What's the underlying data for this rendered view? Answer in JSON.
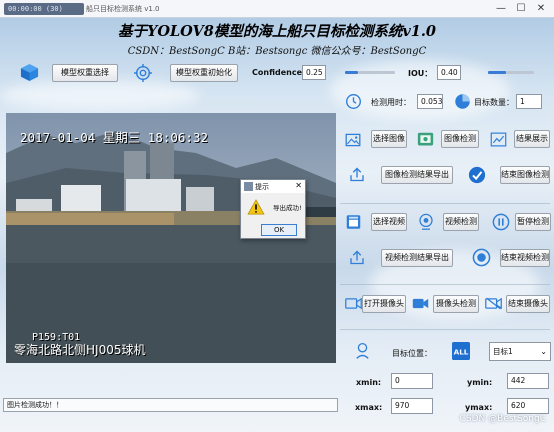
{
  "window": {
    "title_prefix": "基于YOLOv8",
    "fps_readout": "00:00:00 (30)",
    "title": "船只目标检测系统 v1.0",
    "minimize_label": "—",
    "maximize_label": "☐",
    "close_label": "✕"
  },
  "header": {
    "title": "基于YOLOV8模型的海上船只目标检测系统v1.0",
    "subtitle": "CSDN：BestSongC   B站：Bestsongc   微信公众号：BestSongC"
  },
  "toolbar": {
    "select_weights_label": "模型权重选择",
    "init_weights_label": "模型权重初始化",
    "confidence_label": "Confidence:",
    "confidence_value": "0.25",
    "confidence_level": 0.25,
    "iou_label": "IOU：",
    "iou_value": "0.40",
    "iou_level": 0.4
  },
  "stats": {
    "time_label": "检测用时：",
    "time_value": "0.053",
    "count_label": "目标数量：",
    "count_value": "1"
  },
  "image_controls": {
    "select_image_label": "选择图像",
    "detect_image_label": "图像检测",
    "show_result_label": "结果展示",
    "export_image_result_label": "图像检测结果导出",
    "end_image_detect_label": "结束图像检测"
  },
  "video_controls": {
    "select_video_label": "选择视频",
    "detect_video_label": "视频检测",
    "pause_label": "暂停检测",
    "export_video_result_label": "视频检测结果导出",
    "end_video_detect_label": "结束视频检测"
  },
  "camera_controls": {
    "open_camera_label": "打开摄像头",
    "camera_detect_label": "摄像头检测",
    "close_camera_label": "结束摄像头"
  },
  "target": {
    "position_label": "目标位置：",
    "select_value": "目标1",
    "xmin_label": "xmin:",
    "xmin_value": "0",
    "ymin_label": "ymin:",
    "ymin_value": "442",
    "xmax_label": "xmax:",
    "xmax_value": "970",
    "ymax_label": "ymax:",
    "ymax_value": "620"
  },
  "video_frame": {
    "timestamp": "2017-01-04 星期三 18:06:32",
    "camera_label": "零海北路北侧HJ005球机",
    "overlay_tag": "P159:T01"
  },
  "dialog": {
    "title": "提示",
    "message": "导出成功!",
    "ok_label": "OK",
    "close_label": "✕"
  },
  "status": {
    "text": "图片检测成功！！"
  },
  "watermark": "CSDN @BestSongC",
  "colors": {
    "accent": "#2f7fd8",
    "slider": "#3a7bd5",
    "check": "#1f6fd1"
  }
}
